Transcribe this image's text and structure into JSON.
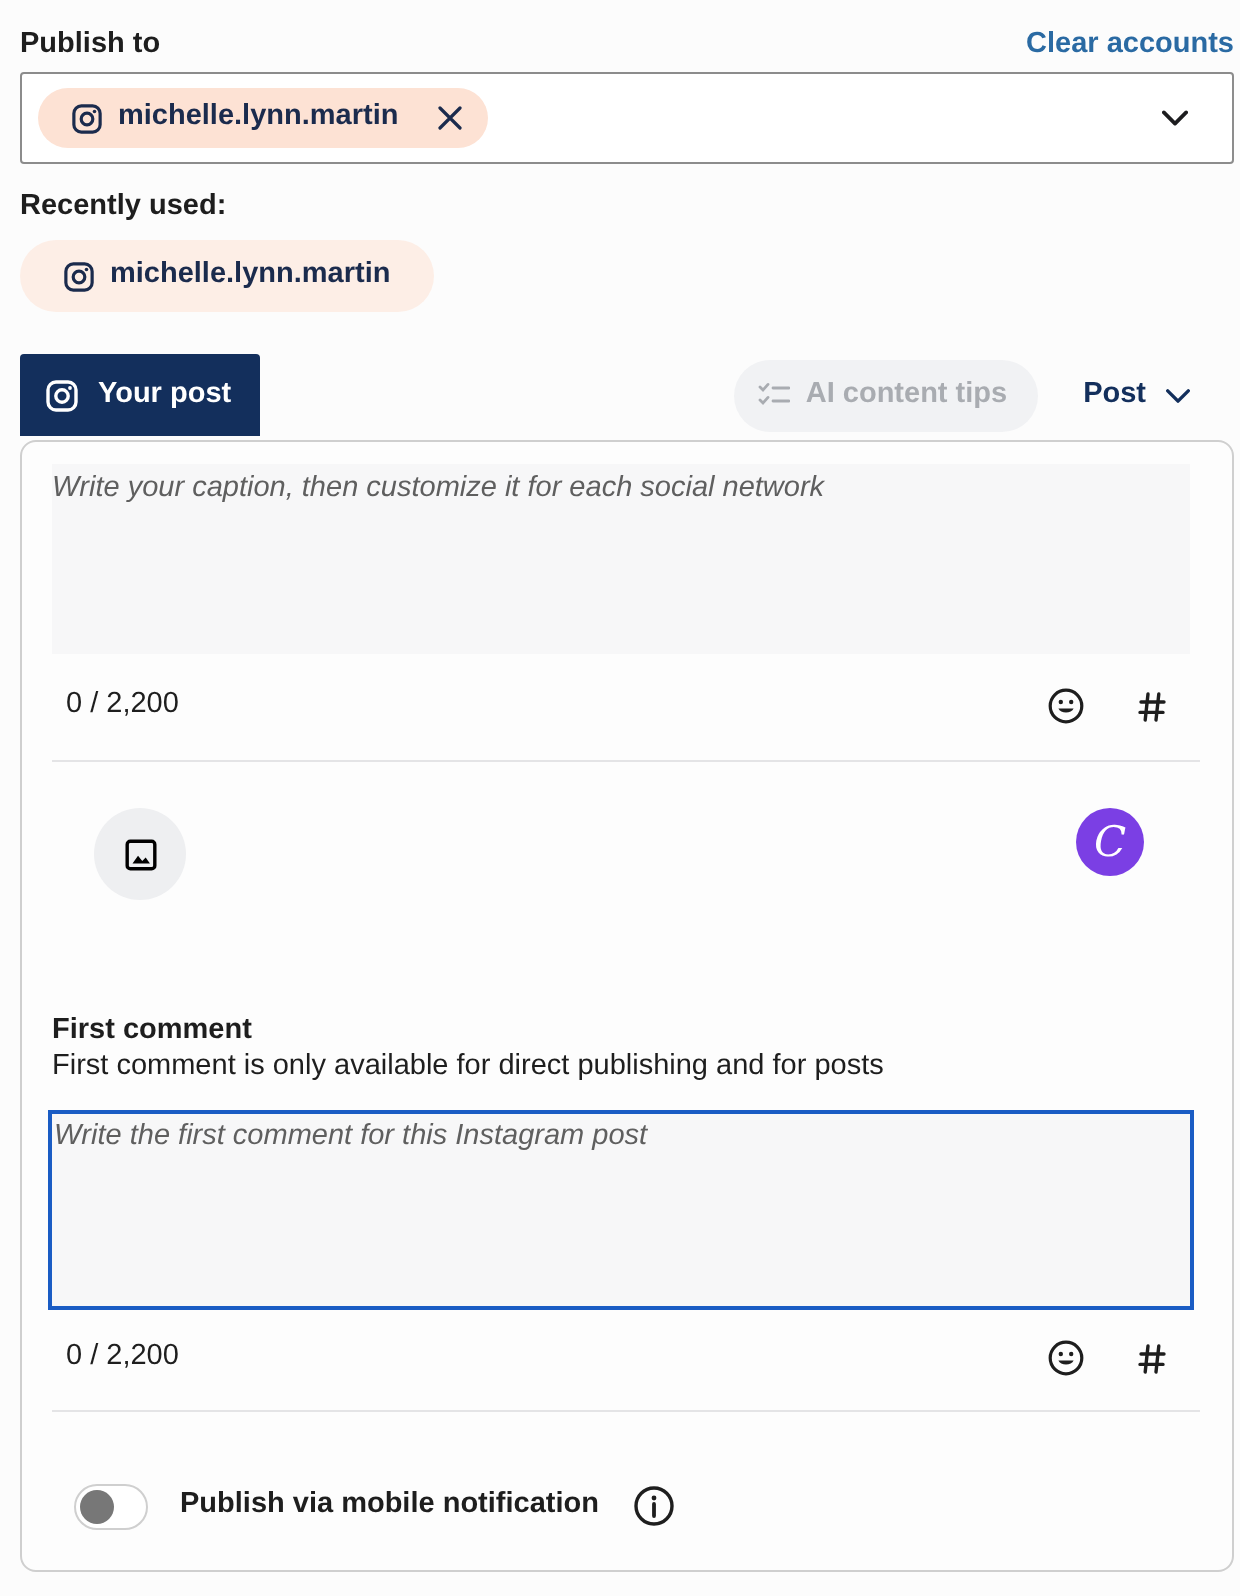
{
  "publish_to": {
    "label": "Publish to",
    "clear_link": "Clear accounts",
    "selected_accounts": [
      {
        "name": "michelle.lynn.martin"
      }
    ]
  },
  "recently_used": {
    "label": "Recently used:",
    "accounts": [
      {
        "name": "michelle.lynn.martin"
      }
    ]
  },
  "tabs": [
    {
      "label": "Your post",
      "selected": true
    }
  ],
  "ai_tips": {
    "label": "AI content tips",
    "disabled": true
  },
  "post_type": {
    "label": "Post"
  },
  "caption": {
    "placeholder": "Write your caption, then customize it for each social network",
    "count": "0 / 2,200",
    "focused": false
  },
  "media": {
    "design_button": "C"
  },
  "first_comment": {
    "title": "First comment",
    "note": "First comment is only available for direct publishing and for posts",
    "placeholder": "Write the first comment for this Instagram post",
    "count": "0 / 2,200",
    "focused": true
  },
  "mobile_notification": {
    "label": "Publish via mobile notification",
    "on": false
  }
}
